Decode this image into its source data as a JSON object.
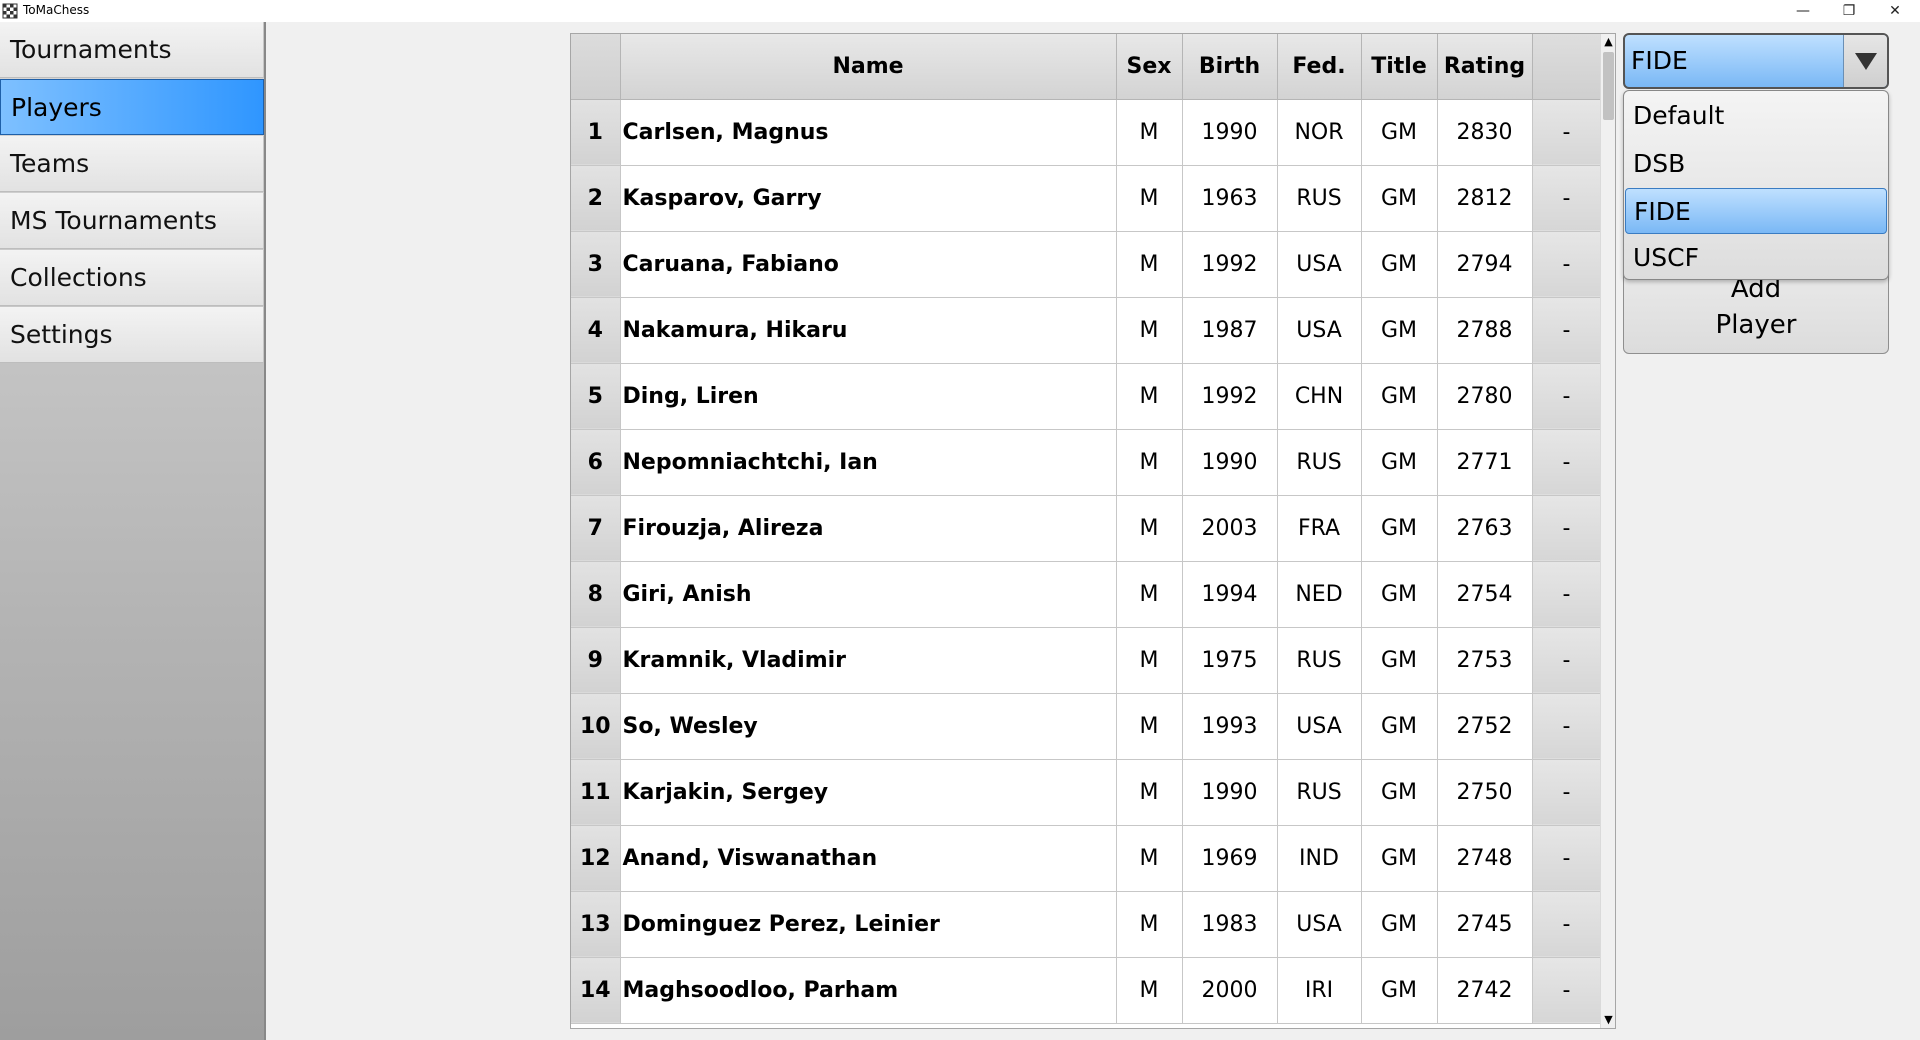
{
  "window": {
    "title": "ToMaChess",
    "controls": {
      "minimize": "—",
      "restore": "❐",
      "close": "✕"
    }
  },
  "sidebar": {
    "items": [
      {
        "label": "Tournaments",
        "active": false
      },
      {
        "label": "Players",
        "active": true
      },
      {
        "label": "Teams",
        "active": false
      },
      {
        "label": "MS Tournaments",
        "active": false
      },
      {
        "label": "Collections",
        "active": false
      },
      {
        "label": "Settings",
        "active": false
      }
    ]
  },
  "table": {
    "columns": [
      "",
      "Name",
      "Sex",
      "Birth",
      "Fed.",
      "Title",
      "Rating",
      ""
    ],
    "rows": [
      [
        "1",
        "Carlsen, Magnus",
        "M",
        "1990",
        "NOR",
        "GM",
        "2830",
        "-"
      ],
      [
        "2",
        "Kasparov, Garry",
        "M",
        "1963",
        "RUS",
        "GM",
        "2812",
        "-"
      ],
      [
        "3",
        "Caruana, Fabiano",
        "M",
        "1992",
        "USA",
        "GM",
        "2794",
        "-"
      ],
      [
        "4",
        "Nakamura, Hikaru",
        "M",
        "1987",
        "USA",
        "GM",
        "2788",
        "-"
      ],
      [
        "5",
        "Ding, Liren",
        "M",
        "1992",
        "CHN",
        "GM",
        "2780",
        "-"
      ],
      [
        "6",
        "Nepomniachtchi, Ian",
        "M",
        "1990",
        "RUS",
        "GM",
        "2771",
        "-"
      ],
      [
        "7",
        "Firouzja, Alireza",
        "M",
        "2003",
        "FRA",
        "GM",
        "2763",
        "-"
      ],
      [
        "8",
        "Giri, Anish",
        "M",
        "1994",
        "NED",
        "GM",
        "2754",
        "-"
      ],
      [
        "9",
        "Kramnik, Vladimir",
        "M",
        "1975",
        "RUS",
        "GM",
        "2753",
        "-"
      ],
      [
        "10",
        "So, Wesley",
        "M",
        "1993",
        "USA",
        "GM",
        "2752",
        "-"
      ],
      [
        "11",
        "Karjakin, Sergey",
        "M",
        "1990",
        "RUS",
        "GM",
        "2750",
        "-"
      ],
      [
        "12",
        "Anand, Viswanathan",
        "M",
        "1969",
        "IND",
        "GM",
        "2748",
        "-"
      ],
      [
        "13",
        "Dominguez Perez, Leinier",
        "M",
        "1983",
        "USA",
        "GM",
        "2745",
        "-"
      ],
      [
        "14",
        "Maghsoodloo, Parham",
        "M",
        "2000",
        "IRI",
        "GM",
        "2742",
        "-"
      ]
    ]
  },
  "rating_list": {
    "selected": "FIDE",
    "options": [
      "Default",
      "DSB",
      "FIDE",
      "USCF"
    ]
  },
  "add_player": {
    "line1": "Add",
    "line2": "Player"
  },
  "colors": {
    "accent": "#2f96ff",
    "selection": "#7ab8f5"
  }
}
